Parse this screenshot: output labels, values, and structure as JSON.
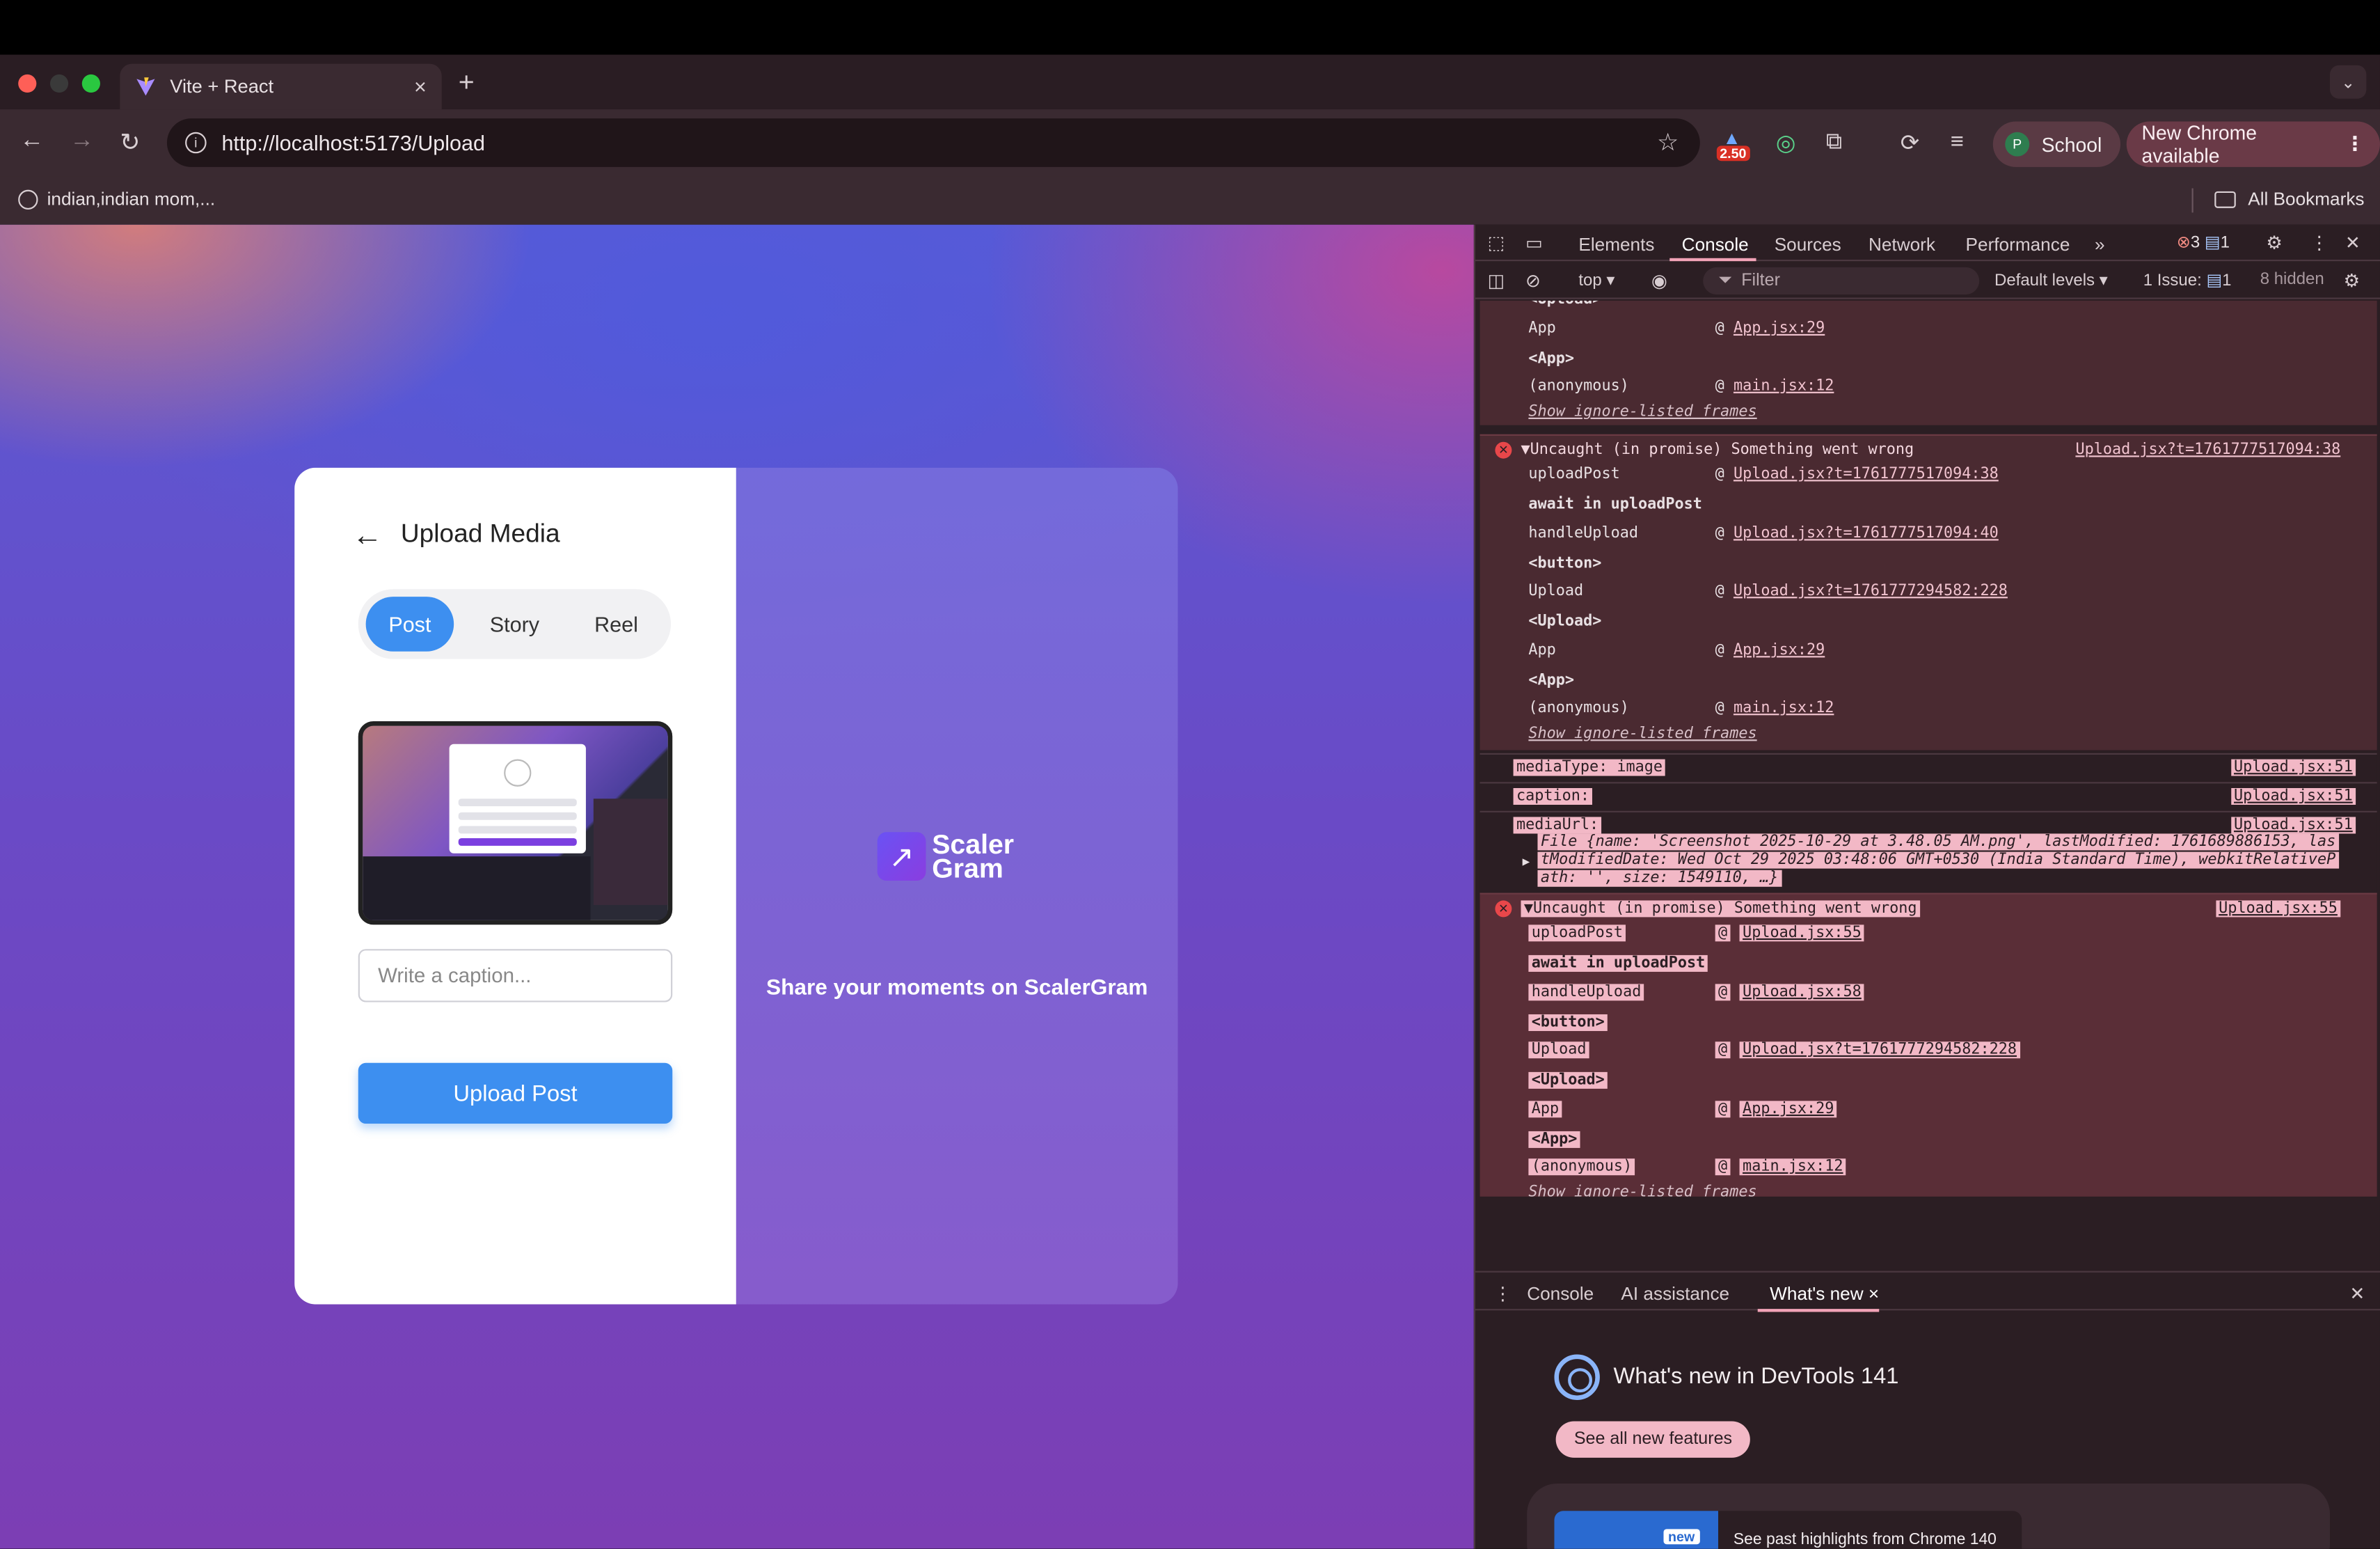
{
  "browser": {
    "tab_title": "Vite + React",
    "tab_close": "×",
    "new_tab": "+",
    "tab_menu": "⌄",
    "url": "http://localhost:5173/Upload",
    "ext_badge": "2.50",
    "profile_initial": "P",
    "profile_name": "School",
    "update_label": "New Chrome available",
    "update_menu": "⋮",
    "bookmark": "indian,indian mom,...",
    "all_bookmarks": "All Bookmarks"
  },
  "app": {
    "title": "Upload Media",
    "back": "←",
    "segments": [
      "Post",
      "Story",
      "Reel"
    ],
    "caption_placeholder": "Write a caption...",
    "upload_button": "Upload Post",
    "logo_line1": "Scaler",
    "logo_line2": "Gram",
    "logo_glyph": "↗",
    "tagline": "Share your moments on ScalerGram"
  },
  "devtools": {
    "tabs": [
      "Elements",
      "Console",
      "Sources",
      "Network",
      "Performance"
    ],
    "more": "»",
    "error_count": "3",
    "message_count": "1",
    "context": "top ▾",
    "filter": "Filter",
    "levels": "Default levels ▾",
    "issues_label": "1 Issue:",
    "issues_count": "1",
    "hidden": "8 hidden",
    "console": {
      "top_partial": "<Upload>",
      "block0": [
        {
          "fn": "App",
          "link": "App.jsx:29"
        },
        {
          "fn": "<App>",
          "bold": true
        },
        {
          "fn": "(anonymous)",
          "link": "main.jsx:12"
        }
      ],
      "show_frames": "Show ignore-listed frames",
      "error1": {
        "header": "▼Uncaught (in promise) Something went wrong",
        "source": "Upload.jsx?t=1761777517094:38",
        "frames": [
          {
            "fn": "uploadPost",
            "link": "Upload.jsx?t=1761777517094:38"
          },
          {
            "fn": "await in uploadPost",
            "bold": true
          },
          {
            "fn": "handleUpload",
            "link": "Upload.jsx?t=1761777517094:40"
          },
          {
            "fn": "<button>",
            "bold": true
          },
          {
            "fn": "Upload",
            "link": "Upload.jsx?t=1761777294582:228"
          },
          {
            "fn": "<Upload>",
            "bold": true
          },
          {
            "fn": "App",
            "link": "App.jsx:29"
          },
          {
            "fn": "<App>",
            "bold": true
          },
          {
            "fn": "(anonymous)",
            "link": "main.jsx:12"
          }
        ]
      },
      "logs": [
        {
          "text": "mediaType: image",
          "link": "Upload.jsx:51"
        },
        {
          "text": "caption: ",
          "link": "Upload.jsx:51"
        },
        {
          "text": "mediaUrl:",
          "link": "Upload.jsx:51"
        }
      ],
      "file_line1": "File {name: 'Screenshot 2025-10-29 at 3.48.05 AM.png', lastModified: 1761689886153, las",
      "file_line2": "tModifiedDate: Wed Oct 29 2025 03:48:06 GMT+0530 (India Standard Time), webkitRelativeP",
      "file_line3": "ath: '', size: 1549110, …}",
      "error2": {
        "header": "▼Uncaught (in promise) Something went wrong",
        "source": "Upload.jsx:55",
        "frames": [
          {
            "fn": "uploadPost",
            "link": "Upload.jsx:55"
          },
          {
            "fn": "await in uploadPost",
            "bold": true
          },
          {
            "fn": "handleUpload",
            "link": "Upload.jsx:58"
          },
          {
            "fn": "<button>",
            "bold": true
          },
          {
            "fn": "Upload",
            "link": "Upload.jsx?t=1761777294582:228"
          },
          {
            "fn": "<Upload>",
            "bold": true
          },
          {
            "fn": "App",
            "link": "App.jsx:29"
          },
          {
            "fn": "<App>",
            "bold": true
          },
          {
            "fn": "(anonymous)",
            "link": "main.jsx:12"
          }
        ]
      },
      "prompt": "›"
    },
    "drawer": {
      "tabs": [
        "Console",
        "AI assistance",
        "What's new ×"
      ],
      "title": "What's new in DevTools 141",
      "button": "See all new features",
      "badge": "new",
      "highlight": "See past highlights from Chrome 140"
    }
  },
  "colors": {
    "accent": "#3d8ff0",
    "error": "#e8474a",
    "devtools_bg": "#2b1e23"
  }
}
